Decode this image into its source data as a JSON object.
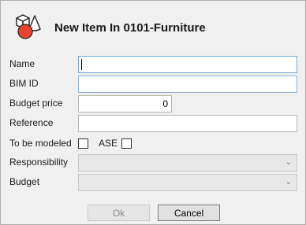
{
  "dialog": {
    "title": "New Item In 0101-Furniture",
    "logo_icon": "shapes-icon"
  },
  "form": {
    "name_label": "Name",
    "name_value": "",
    "bim_id_label": "BIM ID",
    "bim_id_value": "",
    "budget_price_label": "Budget price",
    "budget_price_value": "0",
    "reference_label": "Reference",
    "reference_value": "",
    "to_be_modeled_label": "To be modeled",
    "to_be_modeled_checked": false,
    "ase_label": "ASE",
    "ase_checked": false,
    "responsibility_label": "Responsibility",
    "responsibility_value": "",
    "budget_label": "Budget",
    "budget_value": ""
  },
  "buttons": {
    "ok_label": "Ok",
    "cancel_label": "Cancel"
  },
  "colors": {
    "logo_red": "#e8452c",
    "focus_border": "#6ea8d6"
  }
}
